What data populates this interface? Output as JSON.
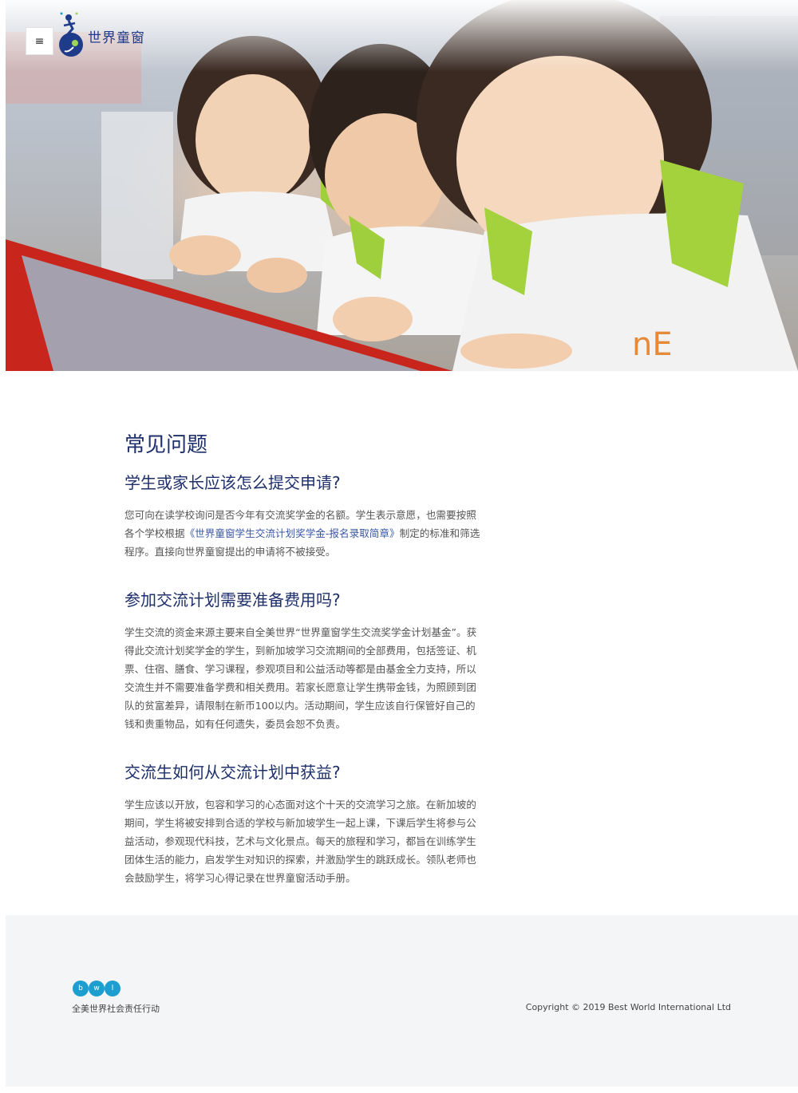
{
  "header": {
    "menu_icon": "hamburger-icon",
    "menu_glyph": "≡",
    "brand_name": "世界童窗",
    "brand_color": "#1f3c8a"
  },
  "hero": {
    "image_description_icon": "hero-photo"
  },
  "faq": {
    "title": "常见问题",
    "items": [
      {
        "question": "学生或家长应该怎么提交申请?",
        "answer_before": "您可向在读学校询问是否今年有交流奖学金的名额。学生表示意愿，也需要按照各个学校根据",
        "answer_link": "《世界童窗学生交流计划奖学金-报名录取简章》",
        "answer_after": "制定的标准和筛选程序。直接向世界童窗提出的申请将不被接受。"
      },
      {
        "question": "参加交流计划需要准备费用吗?",
        "answer": "学生交流的资金来源主要来自全美世界“世界童窗学生交流奖学金计划基金”。获得此交流计划奖学金的学生，到新加坡学习交流期间的全部费用，包括签证、机票、住宿、膳食、学习课程，参观项目和公益活动等都是由基金全力支持，所以交流生并不需要准备学费和相关费用。若家长愿意让学生携带金钱，为照顾到团队的贫富差异，请限制在新币100以内。活动期间，学生应该自行保管好自己的钱和贵重物品，如有任何遗失，委员会恕不负责。"
      },
      {
        "question": "交流生如何从交流计划中获益?",
        "answer": "学生应该以开放，包容和学习的心态面对这个十天的交流学习之旅。在新加坡的期间，学生将被安排到合适的学校与新加坡学生一起上课，下课后学生将参与公益活动，参观现代科技，艺术与文化景点。每天的旅程和学习，都旨在训练学生团体生活的能力，启发学生对知识的探索，并激励学生的跳跃成长。领队老师也会鼓励学生，将学习心得记录在世界童窗活动手册。"
      }
    ],
    "heading_color": "#1e2f6b",
    "link_color": "#3a57a6"
  },
  "footer": {
    "logo_letters": [
      "b",
      "w",
      "l"
    ],
    "logo_color": "#1d9ecf",
    "tagline": "全美世界社会责任行动",
    "copyright": "Copyright © 2019 Best World International Ltd"
  }
}
